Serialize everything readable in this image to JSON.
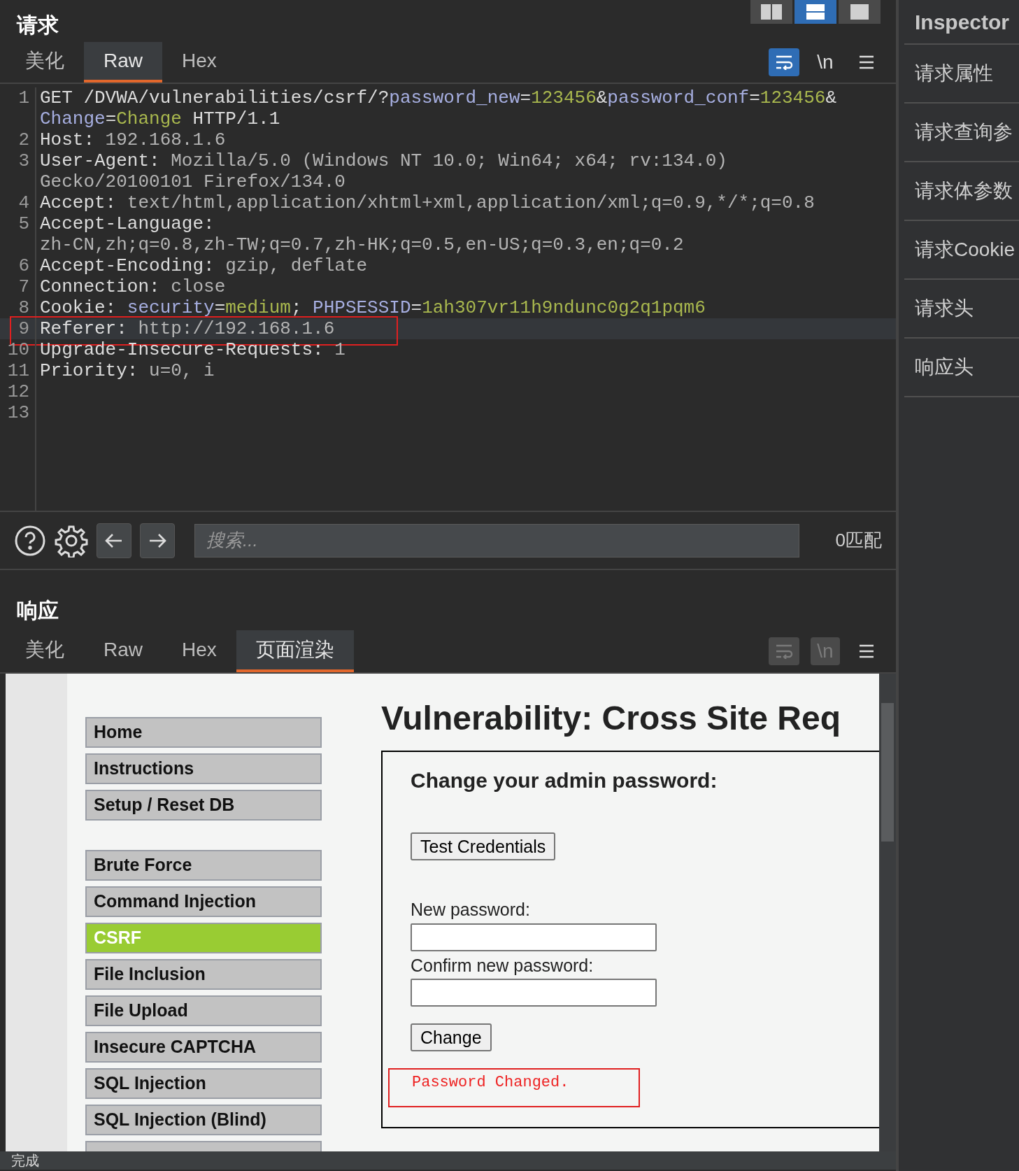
{
  "request": {
    "title": "请求",
    "layout_buttons": [
      {
        "selected": false
      },
      {
        "selected": true
      },
      {
        "selected": false
      }
    ],
    "tabs": [
      {
        "label": "美化",
        "selected": false
      },
      {
        "label": "Raw",
        "selected": true
      },
      {
        "label": "Hex",
        "selected": false
      }
    ],
    "toggles": [
      {
        "kind": "wrap",
        "on": true,
        "disabled": false
      },
      {
        "kind": "newline",
        "label": "\\n",
        "on": false,
        "disabled": false
      },
      {
        "kind": "menu",
        "on": false,
        "disabled": false
      }
    ],
    "lines": [
      {
        "number": "1",
        "highlighted": false,
        "boxed": false,
        "segments": [
          {
            "text": "GET /DVWA/vulnerabilities/csrf/?",
            "kind": "name"
          },
          {
            "text": "password_new",
            "kind": "param"
          },
          {
            "text": "=",
            "kind": "name"
          },
          {
            "text": "123456",
            "kind": "value"
          },
          {
            "text": "&",
            "kind": "name"
          },
          {
            "text": "password_conf",
            "kind": "param"
          },
          {
            "text": "=",
            "kind": "name"
          },
          {
            "text": "123456",
            "kind": "value"
          },
          {
            "text": "&",
            "kind": "name"
          }
        ]
      },
      {
        "highlighted": false,
        "boxed": false,
        "segments": [
          {
            "text": "Change",
            "kind": "param"
          },
          {
            "text": "=",
            "kind": "name"
          },
          {
            "text": "Change",
            "kind": "value"
          },
          {
            "text": " HTTP/1.1",
            "kind": "name"
          }
        ]
      },
      {
        "number": "2",
        "highlighted": false,
        "boxed": false,
        "segments": [
          {
            "text": "Host:",
            "kind": "name"
          },
          {
            "text": " 192.168.1.6",
            "kind": "text"
          }
        ]
      },
      {
        "number": "3",
        "highlighted": false,
        "boxed": false,
        "segments": [
          {
            "text": "User-Agent:",
            "kind": "name"
          },
          {
            "text": " Mozilla/5.0 (Windows NT 10.0; Win64; x64; rv:134.0)",
            "kind": "text"
          }
        ]
      },
      {
        "highlighted": false,
        "boxed": false,
        "segments": [
          {
            "text": "Gecko/20100101 Firefox/134.0",
            "kind": "text"
          }
        ]
      },
      {
        "number": "4",
        "highlighted": false,
        "boxed": false,
        "segments": [
          {
            "text": "Accept:",
            "kind": "name"
          },
          {
            "text": " text/html,application/xhtml+xml,application/xml;q=0.9,*/*;q=0.8",
            "kind": "text"
          }
        ]
      },
      {
        "number": "5",
        "highlighted": false,
        "boxed": false,
        "segments": [
          {
            "text": "Accept-Language:",
            "kind": "name"
          }
        ]
      },
      {
        "highlighted": false,
        "boxed": false,
        "segments": [
          {
            "text": "zh-CN,zh;q=0.8,zh-TW;q=0.7,zh-HK;q=0.5,en-US;q=0.3,en;q=0.2",
            "kind": "text"
          }
        ]
      },
      {
        "number": "6",
        "highlighted": false,
        "boxed": false,
        "segments": [
          {
            "text": "Accept-Encoding:",
            "kind": "name"
          },
          {
            "text": " gzip, deflate",
            "kind": "text"
          }
        ]
      },
      {
        "number": "7",
        "highlighted": false,
        "boxed": false,
        "segments": [
          {
            "text": "Connection:",
            "kind": "name"
          },
          {
            "text": " close",
            "kind": "text"
          }
        ]
      },
      {
        "number": "8",
        "highlighted": false,
        "boxed": false,
        "segments": [
          {
            "text": "Cookie: ",
            "kind": "name"
          },
          {
            "text": "security",
            "kind": "param"
          },
          {
            "text": "=",
            "kind": "name"
          },
          {
            "text": "medium",
            "kind": "value"
          },
          {
            "text": "; ",
            "kind": "name"
          },
          {
            "text": "PHPSESSID",
            "kind": "param"
          },
          {
            "text": "=",
            "kind": "name"
          },
          {
            "text": "1ah307vr11h9ndunc0g2q1pqm6",
            "kind": "value"
          }
        ]
      },
      {
        "number": "9",
        "highlighted": true,
        "boxed": true,
        "segments": [
          {
            "text": "Referer:",
            "kind": "name"
          },
          {
            "text": " http://192.168.1.6",
            "kind": "text"
          }
        ]
      },
      {
        "number": "10",
        "highlighted": false,
        "boxed": false,
        "segments": [
          {
            "text": "Upgrade-Insecure-Requests:",
            "kind": "name"
          },
          {
            "text": " 1",
            "kind": "text"
          }
        ]
      },
      {
        "number": "11",
        "highlighted": false,
        "boxed": false,
        "segments": [
          {
            "text": "Priority:",
            "kind": "name"
          },
          {
            "text": " u=0, i",
            "kind": "text"
          }
        ]
      },
      {
        "number": "12",
        "highlighted": false,
        "boxed": false
      },
      {
        "number": "13",
        "highlighted": false,
        "boxed": false
      }
    ],
    "search": {
      "placeholder": "搜索...",
      "matches": "0匹配"
    }
  },
  "response": {
    "title": "响应",
    "tabs": [
      {
        "label": "美化",
        "selected": false
      },
      {
        "label": "Raw",
        "selected": false
      },
      {
        "label": "Hex",
        "selected": false
      },
      {
        "label": "页面渲染",
        "selected": true
      }
    ],
    "toggles": [
      {
        "kind": "wrap",
        "on": false,
        "disabled": true
      },
      {
        "kind": "newline",
        "label": "\\n",
        "on": false,
        "disabled": true
      },
      {
        "kind": "menu",
        "on": false,
        "disabled": false
      }
    ],
    "page": {
      "menu_groups": [
        [
          {
            "label": "Home",
            "selected": false
          },
          {
            "label": "Instructions",
            "selected": false
          },
          {
            "label": "Setup / Reset DB",
            "selected": false
          }
        ],
        [
          {
            "label": "Brute Force",
            "selected": false
          },
          {
            "label": "Command Injection",
            "selected": false
          },
          {
            "label": "CSRF",
            "selected": true
          },
          {
            "label": "File Inclusion",
            "selected": false
          },
          {
            "label": "File Upload",
            "selected": false
          },
          {
            "label": "Insecure CAPTCHA",
            "selected": false
          },
          {
            "label": "SQL Injection",
            "selected": false
          },
          {
            "label": "SQL Injection (Blind)",
            "selected": false
          }
        ]
      ],
      "heading": "Vulnerability: Cross Site Req",
      "form_title": "Change your admin password:",
      "test_button": "Test Credentials",
      "new_password_label": "New password:",
      "confirm_password_label": "Confirm new password:",
      "change_button": "Change",
      "result": "Password Changed."
    }
  },
  "inspector": {
    "title": "Inspector",
    "items": [
      "请求属性",
      "请求查询参",
      "请求体参数",
      "请求Cookie",
      "请求头",
      "响应头"
    ]
  },
  "status_bar": {
    "text": "完成"
  }
}
